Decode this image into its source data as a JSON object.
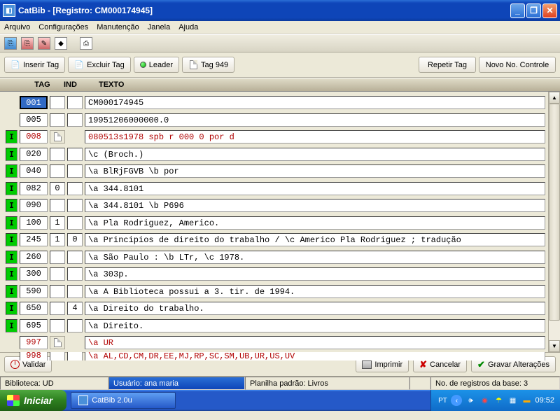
{
  "window": {
    "title": "CatBib - [Registro: CM000174945]"
  },
  "menu": {
    "arquivo": "Arquivo",
    "config": "Configurações",
    "manut": "Manutenção",
    "janela": "Janela",
    "ajuda": "Ajuda"
  },
  "actions": {
    "inserir": "Inserir Tag",
    "excluir": "Excluir Tag",
    "leader": "Leader",
    "tag949": "Tag 949",
    "repetir": "Repetir Tag",
    "novo": "Novo No. Controle",
    "validar": "Validar",
    "imprimir": "Imprimir",
    "cancelar": "Cancelar",
    "gravar": "Gravar Alterações"
  },
  "headers": {
    "tag": "TAG",
    "ind": "IND",
    "texto": "TEXTO"
  },
  "rows": [
    {
      "marker": "",
      "tag": "001",
      "tag_sel": true,
      "ff": "",
      "ind1": "",
      "ind2": "",
      "texto": "CM000174945",
      "red": false
    },
    {
      "marker": "",
      "tag": "005",
      "tag_sel": false,
      "ff": "",
      "ind1": "",
      "ind2": "",
      "texto": "19951206000000.0",
      "red": false
    },
    {
      "marker": "I",
      "tag": "008",
      "tag_sel": false,
      "ff": "ic",
      "ind1": "",
      "ind2": "",
      "texto": "080513s1978    spb     r     000 0 por d",
      "red": true
    },
    {
      "marker": "I",
      "tag": "020",
      "tag_sel": false,
      "ff": "",
      "ind1": "",
      "ind2": "",
      "texto": "\\c (Broch.)",
      "red": false
    },
    {
      "marker": "I",
      "tag": "040",
      "tag_sel": false,
      "ff": "",
      "ind1": "",
      "ind2": "",
      "texto": "\\a BlRjFGVB \\b por",
      "red": false
    },
    {
      "marker": "I",
      "tag": "082",
      "tag_sel": false,
      "ff": "",
      "ind1": "0",
      "ind2": "",
      "texto": "\\a 344.8101",
      "red": false
    },
    {
      "marker": "I",
      "tag": "090",
      "tag_sel": false,
      "ff": "",
      "ind1": "",
      "ind2": "",
      "texto": "\\a 344.8101 \\b P696",
      "red": false
    },
    {
      "marker": "I",
      "tag": "100",
      "tag_sel": false,
      "ff": "",
      "ind1": "1",
      "ind2": "",
      "texto": "\\a Pla Rodriguez, Americo.",
      "red": false
    },
    {
      "marker": "I",
      "tag": "245",
      "tag_sel": false,
      "ff": "",
      "ind1": "1",
      "ind2": "0",
      "texto": "\\a Principios de direito do trabalho / \\c Americo Pla Rodriguez ; tradução",
      "red": false
    },
    {
      "marker": "I",
      "tag": "260",
      "tag_sel": false,
      "ff": "",
      "ind1": "",
      "ind2": "",
      "texto": "\\a São Paulo : \\b LTr, \\c 1978.",
      "red": false
    },
    {
      "marker": "I",
      "tag": "300",
      "tag_sel": false,
      "ff": "",
      "ind1": "",
      "ind2": "",
      "texto": "\\a 303p.",
      "red": false
    },
    {
      "marker": "I",
      "tag": "590",
      "tag_sel": false,
      "ff": "",
      "ind1": "",
      "ind2": "",
      "texto": "\\a A Biblioteca possui a 3. tir. de 1994.",
      "red": false
    },
    {
      "marker": "I",
      "tag": "650",
      "tag_sel": false,
      "ff": "",
      "ind1": "",
      "ind2": "4",
      "texto": "\\a Direito do trabalho.",
      "red": false
    },
    {
      "marker": "I",
      "tag": "695",
      "tag_sel": false,
      "ff": "",
      "ind1": "",
      "ind2": "",
      "texto": "\\a Direito.",
      "red": false
    },
    {
      "marker": "",
      "tag": "997",
      "tag_sel": false,
      "ff": "ic",
      "ind1": "",
      "ind2": "",
      "texto": "\\a UR",
      "red": true
    },
    {
      "marker": "",
      "tag": "998",
      "tag_sel": false,
      "ff": "",
      "ind1": "",
      "ind2": "",
      "texto": "\\a AL,CD,CM,DR,EE,MJ,RP,SC,SM,UB,UR,US,UV",
      "red": true,
      "partial": true
    }
  ],
  "status": {
    "biblioteca": "Biblioteca: UD",
    "usuario": "Usuário: ana maria",
    "planilha": "Planilha padrão: Livros",
    "registros": "No. de registros da base: 3"
  },
  "taskbar": {
    "start": "Iniciar",
    "task1": "CatBib 2.0u",
    "lang": "PT",
    "clock": "09:52"
  }
}
